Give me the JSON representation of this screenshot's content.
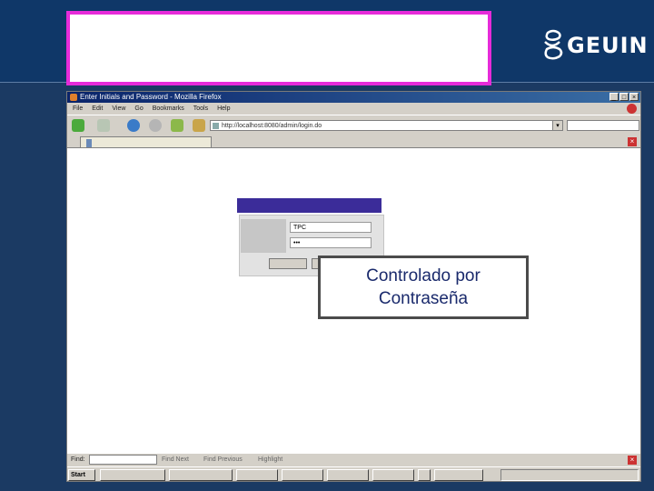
{
  "slide": {
    "logo_text": "GEUIN",
    "caption_line1": "Controlado por",
    "caption_line2": "Contraseña"
  },
  "browser": {
    "window_title": "Enter Initials and Password - Mozilla Firefox",
    "menu": [
      "File",
      "Edit",
      "View",
      "Go",
      "Bookmarks",
      "Tools",
      "Help"
    ],
    "url": "http://localhost:8080/admin/login.do",
    "find_label": "Find:",
    "find_next": "Find Next",
    "find_previous": "Find Previous",
    "highlight": "Highlight"
  },
  "login": {
    "initials_value": "TPC",
    "password_value": "•••"
  },
  "taskbar": {
    "start_label": "Start"
  },
  "colors": {
    "slide_background": "#0f3768",
    "highlight_border": "#e62bd9",
    "login_header": "#3b2c99",
    "caption_text": "#1a2a6c"
  }
}
